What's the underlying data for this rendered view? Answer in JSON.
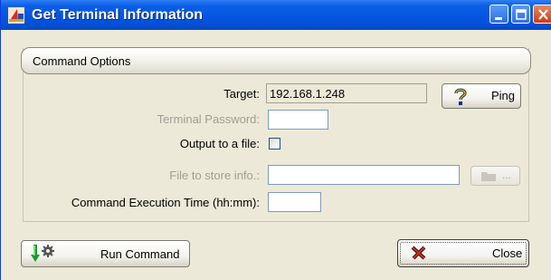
{
  "window": {
    "title": "Get Terminal Information",
    "controls": {
      "minimize_icon": "minimize-icon",
      "maximize_icon": "maximize-icon",
      "close_icon": "close-x-icon"
    }
  },
  "group": {
    "header": "Command Options"
  },
  "form": {
    "target_label": "Target:",
    "target_value": "192.168.1.248",
    "password_label": "Terminal Password:",
    "password_value": "",
    "output_label": "Output to a file:",
    "output_checked": false,
    "file_label": "File to store info.:",
    "file_value": "",
    "time_label": "Command Execution Time (hh:mm):",
    "time_value": ""
  },
  "buttons": {
    "ping_label": "Ping",
    "browse_label": "...",
    "run_label": "Run Command",
    "close_label": "Close"
  },
  "colors": {
    "titlebar": "#0554e0",
    "window_bg": "#ece9d8",
    "disabled_text": "#a09e94"
  }
}
